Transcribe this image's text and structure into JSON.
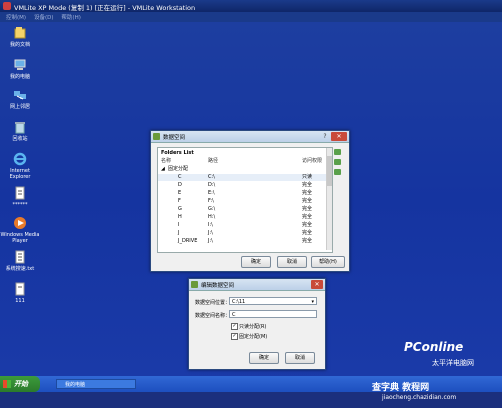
{
  "app": {
    "title": "VMLite XP Mode (复制 1) [正在运行] - VMLite Workstation",
    "menu": [
      "控制(M)",
      "设备(D)",
      "帮助(H)"
    ]
  },
  "desktop_icons": [
    {
      "label": "我的文档",
      "icon": "my-documents-icon"
    },
    {
      "label": "我的电脑",
      "icon": "my-computer-icon"
    },
    {
      "label": "网上邻居",
      "icon": "network-icon"
    },
    {
      "label": "回收站",
      "icon": "recycle-bin-icon"
    },
    {
      "label": "Internet Explorer",
      "icon": "ie-icon"
    },
    {
      "label": "******",
      "icon": "file-icon"
    },
    {
      "label": "Windows Media Player",
      "icon": "media-player-icon"
    },
    {
      "label": "系统搜速.txt",
      "icon": "text-file-icon"
    },
    {
      "label": "111",
      "icon": "file-icon"
    }
  ],
  "folders_dialog": {
    "title": "数据空间",
    "list_title": "Folders List",
    "columns": [
      "名称",
      "路径",
      "访问权限"
    ],
    "group": "固定分配",
    "rows": [
      {
        "name": "C",
        "path": "C:\\",
        "access": "只读"
      },
      {
        "name": "D",
        "path": "D:\\",
        "access": "完全"
      },
      {
        "name": "E",
        "path": "E:\\",
        "access": "完全"
      },
      {
        "name": "F",
        "path": "F:\\",
        "access": "完全"
      },
      {
        "name": "G",
        "path": "G:\\",
        "access": "完全"
      },
      {
        "name": "H",
        "path": "H:\\",
        "access": "完全"
      },
      {
        "name": "I",
        "path": "I:\\",
        "access": "完全"
      },
      {
        "name": "J",
        "path": "J:\\",
        "access": "完全"
      },
      {
        "name": "J_DRIVE",
        "path": "J:\\",
        "access": "完全"
      }
    ],
    "buttons": {
      "ok": "确定",
      "cancel": "取消",
      "help": "帮助(H)"
    }
  },
  "edit_dialog": {
    "title": "编辑数据空间",
    "path_label": "数据空间位置：",
    "path_value": "C:\\11",
    "name_label": "数据空间名称：",
    "name_value": "C",
    "readonly_label": "只读分配(R)",
    "fixed_label": "固定分配(M)",
    "buttons": {
      "ok": "确定",
      "cancel": "取消"
    }
  },
  "taskbar": {
    "start": "开始",
    "item": "我的电脑"
  },
  "watermark": {
    "brand": "PConline",
    "tagline": "太平洋电脑网",
    "site": "查字典 教程网",
    "url": "jiaocheng.chazidian.com"
  }
}
